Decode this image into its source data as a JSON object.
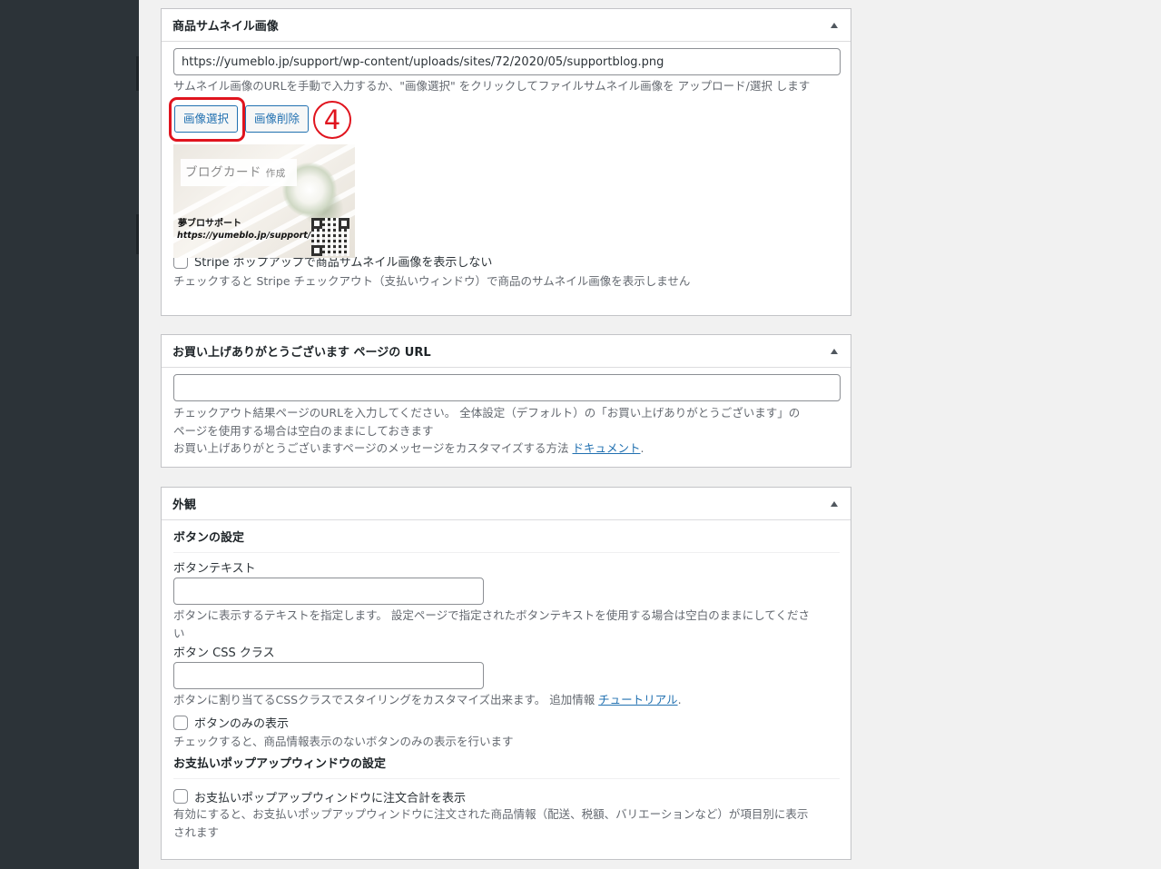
{
  "thumbnail_box": {
    "title": "商品サムネイル画像",
    "url_value": "https://yumeblo.jp/support/wp-content/uploads/sites/72/2020/05/supportblog.png",
    "description": "サムネイル画像のURLを手動で入力するか、\"画像選択\" をクリックしてファイルサムネイル画像を アップロード/選択 します",
    "select_button": "画像選択",
    "remove_button": "画像削除",
    "step_number": "4",
    "preview": {
      "banner_main": "ブログカード",
      "banner_sub": "作成",
      "brand": "夢ブロサポート",
      "url": "https://yumeblo.jp/support/"
    },
    "hide_checkbox_label": "Stripe ポップアップで商品サムネイル画像を表示しない",
    "hide_checkbox_desc": "チェックすると Stripe チェックアウト（支払いウィンドウ）で商品のサムネイル画像を表示しません"
  },
  "thanks_box": {
    "title": "お買い上げありがとうございます ページの URL",
    "url_value": "",
    "desc_line1": "チェックアウト結果ページのURLを入力してください。 全体設定（デフォルト）の「お買い上げありがとうございます」の",
    "desc_line2": "ページを使用する場合は空白のままにしておきます",
    "desc_line3_prefix": "お買い上げありがとうございますページのメッセージをカスタマイズする方法 ",
    "desc_line3_link": "ドキュメント",
    "desc_line3_suffix": "."
  },
  "appearance_box": {
    "title": "外観",
    "button_settings_heading": "ボタンの設定",
    "button_text_label": "ボタンテキスト",
    "button_text_value": "",
    "button_text_desc": "ボタンに表示するテキストを指定します。 設定ページで指定されたボタンテキストを使用する場合は空白のままにしてくださ\nい",
    "button_css_label": "ボタン CSS クラス",
    "button_css_value": "",
    "button_css_desc_prefix": "ボタンに割り当てるCSSクラスでスタイリングをカスタマイズ出来ます。 追加情報 ",
    "button_css_desc_link": "チュートリアル",
    "button_css_desc_suffix": ".",
    "button_only_label": "ボタンのみの表示",
    "button_only_desc": "チェックすると、商品情報表示のないボタンのみの表示を行います",
    "popup_heading": "お支払いポップアップウィンドウの設定",
    "popup_total_label": "お支払いポップアップウィンドウに注文合計を表示",
    "popup_total_desc": "有効にすると、お支払いポップアップウィンドウに注文された商品情報（配送、税額、バリエーションなど）が項目別に表示\nされます"
  },
  "colors": {
    "sidebar": "#2c3338",
    "link": "#2271b1",
    "highlight": "#e0141e"
  }
}
